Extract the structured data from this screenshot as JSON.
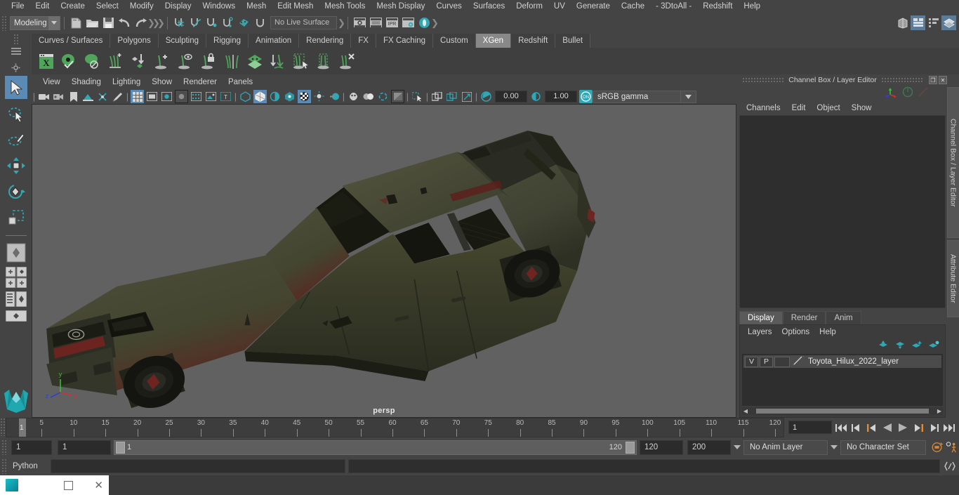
{
  "menubar": {
    "items": [
      "File",
      "Edit",
      "Create",
      "Select",
      "Modify",
      "Display",
      "Windows",
      "Mesh",
      "Edit Mesh",
      "Mesh Tools",
      "Mesh Display",
      "Curves",
      "Surfaces",
      "Deform",
      "UV",
      "Generate",
      "Cache",
      "- 3DtoAll -",
      "Redshift",
      "Help"
    ]
  },
  "statusline": {
    "mode": "Modeling",
    "live_surface": "No Live Surface",
    "icons": [
      "new-scene-icon",
      "open-scene-icon",
      "save-scene-icon",
      "undo-icon",
      "redo-icon",
      "select-by-hierarchy-icon",
      "select-by-object-icon",
      "select-by-component-icon",
      "snap-to-grid-icon",
      "snap-to-curve-icon",
      "snap-to-point-icon",
      "snap-to-projected-center-icon",
      "snap-to-view-plane-icon",
      "make-live-icon",
      "render-view-icon",
      "render-current-frame-icon",
      "ipr-render-icon",
      "render-settings-icon",
      "hypershade-icon"
    ],
    "layout_icons": [
      "toggle-model-panel-icon",
      "toggle-attribute-editor-icon",
      "toggle-tool-settings-icon",
      "toggle-channel-box-icon"
    ]
  },
  "shelf": {
    "tabs": [
      "Curves / Surfaces",
      "Polygons",
      "Sculpting",
      "Rigging",
      "Animation",
      "Rendering",
      "FX",
      "FX Caching",
      "Custom",
      "XGen",
      "Redshift",
      "Bullet"
    ],
    "active_tab": "XGen",
    "icons": [
      "xgen-editor-icon",
      "xgen-preview-icon",
      "xgen-disable-preview-icon",
      "xgen-add-density-icon",
      "xgen-copy-paste-description-icon",
      "xgen-add-guide-icon",
      "xgen-select-guide-icon",
      "xgen-lock-guide-icon",
      "xgen-mirror-guide-icon",
      "xgen-layer-icon",
      "xgen-groom-convert-icon",
      "xgen-select-region-icon",
      "xgen-clump-icon",
      "xgen-delete-guide-icon"
    ]
  },
  "toolbox": {
    "tools": [
      "select-tool",
      "lasso-select-tool",
      "paint-select-tool",
      "move-tool",
      "rotate-tool",
      "scale-tool"
    ],
    "active_tool": "select-tool",
    "layout_buttons": [
      "single-perspective-layout",
      "four-view-layout",
      "persp-outliner-layout",
      "persp-graph-layout",
      "hypershade-layout"
    ],
    "logo": "maya-logo"
  },
  "viewport": {
    "menus": [
      "View",
      "Shading",
      "Lighting",
      "Show",
      "Renderer",
      "Panels"
    ],
    "camera_label": "persp",
    "exposure": "0.00",
    "gamma": "1.00",
    "color_space": "sRGB gamma",
    "background_color": "#616161",
    "axis": {
      "x_label": "x",
      "y_label": "y",
      "z_label": "z",
      "x_color": "#d43030",
      "y_color": "#30c030",
      "z_color": "#3040d0"
    },
    "model": {
      "name": "Toyota Hilux 2022",
      "body_color": "#3f4031",
      "accent_color": "#7c1d1d",
      "tire_color": "#191919"
    }
  },
  "channelbox": {
    "title": "Channel Box / Layer Editor",
    "menus": [
      "Channels",
      "Edit",
      "Object",
      "Show"
    ],
    "window_buttons": [
      "undock-icon",
      "close-icon"
    ],
    "tool_icons": [
      "transform-axis-icon",
      "keyable-icon",
      "muted-icon"
    ]
  },
  "layereditor": {
    "tabs": [
      "Display",
      "Render",
      "Anim"
    ],
    "active_tab": "Display",
    "menus": [
      "Layers",
      "Options",
      "Help"
    ],
    "buttons": [
      "move-layer-up-icon",
      "move-layer-down-icon",
      "create-new-layer-icon",
      "create-layer-from-selected-icon"
    ],
    "layers": [
      {
        "visibility": "V",
        "playback": "P",
        "shading": "",
        "name": "Toyota_Hilux_2022_layer"
      }
    ]
  },
  "sidetabs": [
    "Channel Box / Layer Editor",
    "Attribute Editor"
  ],
  "timeline": {
    "start": 1,
    "end": 120,
    "tick_labels": [
      5,
      10,
      15,
      20,
      25,
      30,
      35,
      40,
      45,
      50,
      55,
      60,
      65,
      70,
      75,
      80,
      85,
      90,
      95,
      100,
      105,
      110,
      115,
      120
    ],
    "current_frame": "1",
    "current_frame_field": "1",
    "playback_buttons": [
      "go-to-start-icon",
      "step-back-keyframe-icon",
      "step-back-frame-icon",
      "play-backwards-icon",
      "play-forwards-icon",
      "step-forward-frame-icon",
      "step-forward-keyframe-icon",
      "go-to-end-icon"
    ]
  },
  "rangeslider": {
    "anim_start": "1",
    "range_start": "1",
    "slider_min": "1",
    "slider_max": "120",
    "range_end": "120",
    "anim_end": "200",
    "anim_layer": "No Anim Layer",
    "character_set": "No Character Set",
    "right_icons": [
      "auto-key-icon",
      "animation-preferences-icon"
    ]
  },
  "commandline": {
    "language": "Python",
    "command_value": "",
    "result_value": "",
    "help_icon": "script-editor-icon"
  },
  "taskbar": {
    "app_icon": "maya-app-icon",
    "buttons": [
      "restore-window-icon",
      "close-window-icon"
    ]
  }
}
